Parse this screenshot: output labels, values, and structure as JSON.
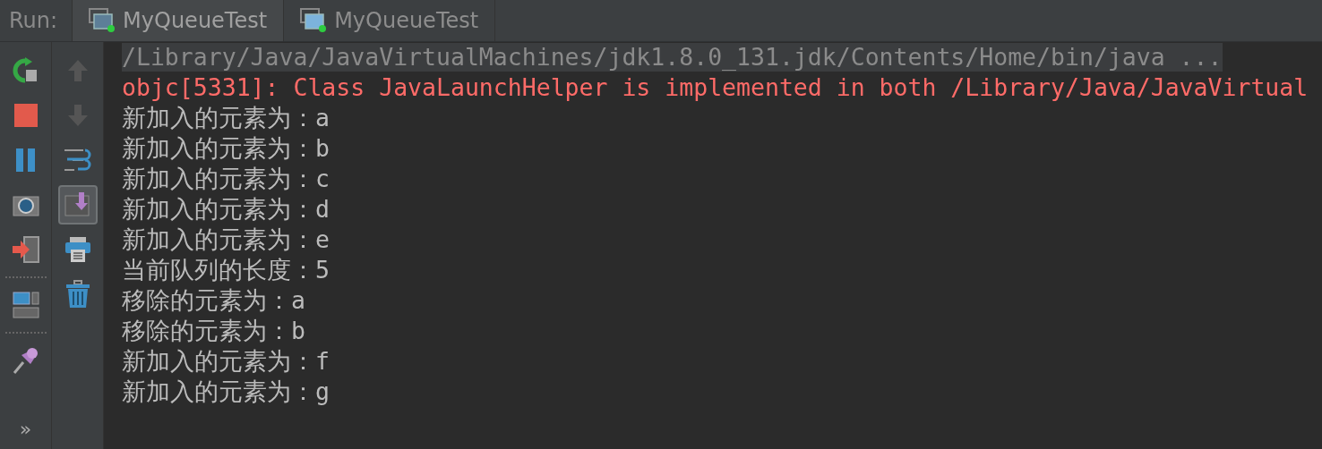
{
  "run_bar": {
    "label": "Run:",
    "tabs": [
      {
        "label": "MyQueueTest",
        "selected": true
      },
      {
        "label": "MyQueueTest",
        "selected": false
      }
    ]
  },
  "left_toolbar": [
    {
      "kind": "rerun"
    },
    {
      "kind": "stop"
    },
    {
      "kind": "pause"
    },
    {
      "kind": "camera"
    },
    {
      "kind": "exit"
    },
    {
      "kind": "separator"
    },
    {
      "kind": "layout"
    },
    {
      "kind": "separator"
    },
    {
      "kind": "pin"
    }
  ],
  "more_button": "»",
  "right_toolbar": [
    {
      "kind": "up",
      "disabled": true
    },
    {
      "kind": "down",
      "disabled": true
    },
    {
      "kind": "wrap",
      "disabled": false
    },
    {
      "kind": "scroll-end",
      "disabled": false,
      "on": true
    },
    {
      "kind": "print",
      "disabled": false
    },
    {
      "kind": "trash",
      "disabled": false
    }
  ],
  "console": [
    {
      "kind": "command",
      "text": "/Library/Java/JavaVirtualMachines/jdk1.8.0_131.jdk/Contents/Home/bin/java ..."
    },
    {
      "kind": "error",
      "text": "objc[5331]: Class JavaLaunchHelper is implemented in both /Library/Java/JavaVirtual"
    },
    {
      "kind": "output",
      "text": "新加入的元素为：a"
    },
    {
      "kind": "output",
      "text": "新加入的元素为：b"
    },
    {
      "kind": "output",
      "text": "新加入的元素为：c"
    },
    {
      "kind": "output",
      "text": "新加入的元素为：d"
    },
    {
      "kind": "output",
      "text": "新加入的元素为：e"
    },
    {
      "kind": "output",
      "text": "当前队列的长度：5"
    },
    {
      "kind": "output",
      "text": "移除的元素为：a"
    },
    {
      "kind": "output",
      "text": "移除的元素为：b"
    },
    {
      "kind": "output",
      "text": "新加入的元素为：f"
    },
    {
      "kind": "output",
      "text": "新加入的元素为：g"
    }
  ]
}
